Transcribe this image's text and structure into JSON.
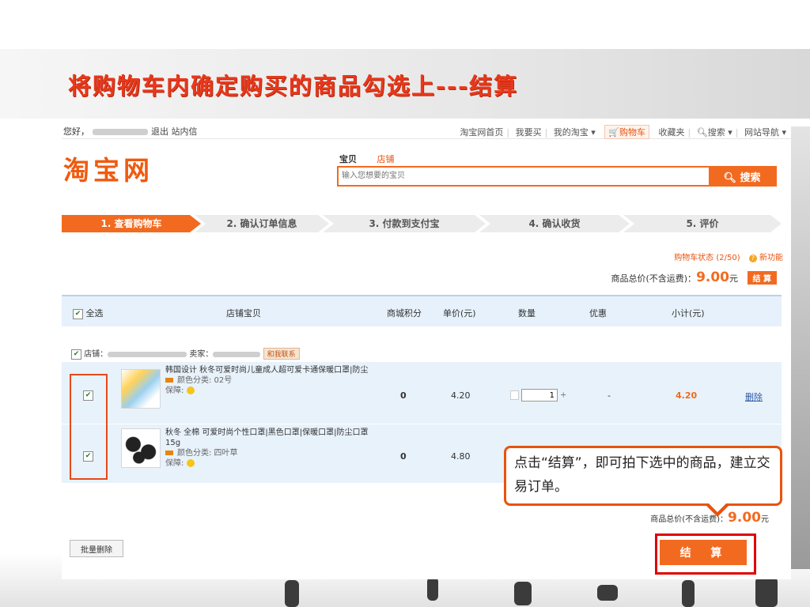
{
  "slide": {
    "title": "将购物车内确定购买的商品勾选上---结算"
  },
  "topbar": {
    "greeting": "您好，",
    "logout": "退出",
    "messages": "站内信",
    "nav": [
      "淘宝网首页",
      "我要买",
      "我的淘宝 ▾",
      "购物车",
      "收藏夹",
      "搜索 ▾",
      "网站导航 ▾"
    ]
  },
  "header": {
    "logo": "淘宝网",
    "search_tabs": [
      "宝贝",
      "店铺"
    ],
    "search_placeholder": "输入您想要的宝贝",
    "search_button": "搜索"
  },
  "steps": [
    "1. 查看购物车",
    "2. 确认订单信息",
    "3. 付款到支付宝",
    "4. 确认收货",
    "5. 评价"
  ],
  "cart_status": {
    "label": "购物车状态 (2/50)",
    "new_feature": "新功能"
  },
  "total_top": {
    "label": "商品总价(不含运费)：",
    "amount": "9.00",
    "unit": "元",
    "checkout": "结 算"
  },
  "table": {
    "headers": [
      "全选",
      "店铺宝贝",
      "商城积分",
      "单价(元)",
      "数量",
      "优惠",
      "小计(元)"
    ],
    "shop_label": "店铺：",
    "seller_label": "卖家：",
    "contact": "和我联系"
  },
  "items": [
    {
      "name": "韩国设计 秋冬可爱时尚儿童成人超可爱卡通保暖口罩|防尘",
      "color": "颜色分类: 02号",
      "guarantee": "保障:",
      "points": "0",
      "price": "4.20",
      "quantity": "1",
      "discount": "-",
      "subtotal": "4.20",
      "delete": "删除"
    },
    {
      "name": "秋冬 全棉 可爱时尚个性口罩|黑色口罩|保暖口罩|防尘口罩 15g",
      "color": "颜色分类: 四叶草",
      "guarantee": "保障:",
      "points": "0",
      "price": "4.80"
    }
  ],
  "total_bottom": {
    "label": "商品总价(不含运费)：",
    "amount": "9.00",
    "unit": "元"
  },
  "buttons": {
    "batch_delete": "批量删除",
    "checkout": "结 算"
  },
  "callout": {
    "text": "点击“结算”，即可拍下选中的商品，建立交易订单。"
  },
  "colors": {
    "accent": "#f26a20",
    "title_red": "#e8381b",
    "highlight_red": "#e00000",
    "row_bg": "#e8f2fb"
  }
}
